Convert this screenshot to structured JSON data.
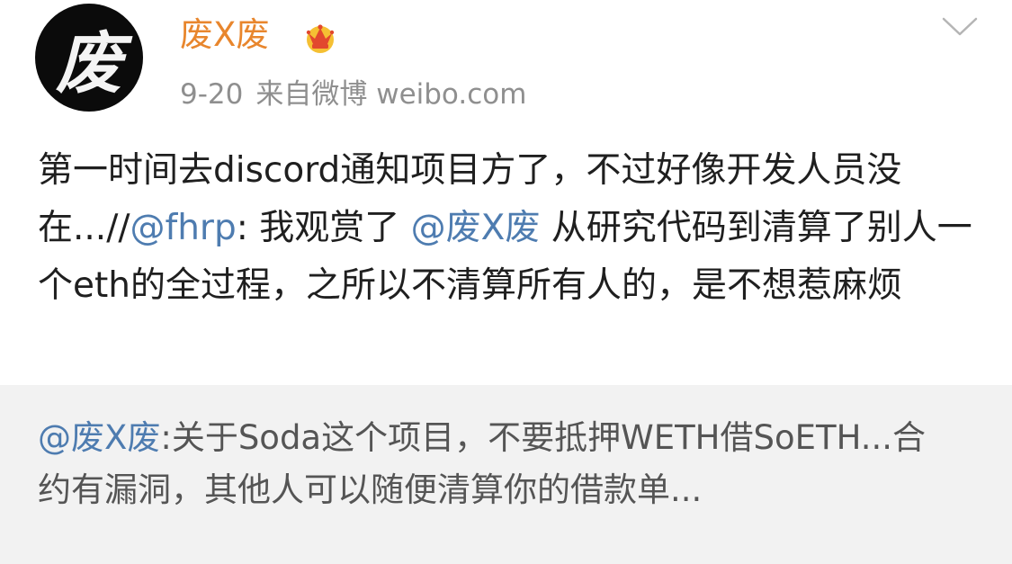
{
  "post": {
    "avatar_char": "废",
    "author": "废X废",
    "date": "9-20",
    "source": "来自微博 weibo.com",
    "text_part1": "第一时间去discord通知项目方了，不过好像开发人员没在...//",
    "mention1": "@fhrp",
    "text_part2": ": 我观赏了 ",
    "mention2": "@废X废",
    "text_part3": " 从研究代码到清算了别人一个eth的全过程，之所以不清算所有人的，是不想惹麻烦"
  },
  "retweet": {
    "author": "@废X废",
    "text": ":关于Soda这个项目，不要抵押WETH借SoETH...合约有漏洞，其他人可以随便清算你的借款单..."
  },
  "icons": {
    "vip_badge": "crown-icon",
    "menu": "chevron-down-icon"
  },
  "colors": {
    "author_name": "#e8862d",
    "link": "#4e7cb0",
    "retweet_bg": "#f2f2f2",
    "meta_text": "#8f8f8f"
  }
}
